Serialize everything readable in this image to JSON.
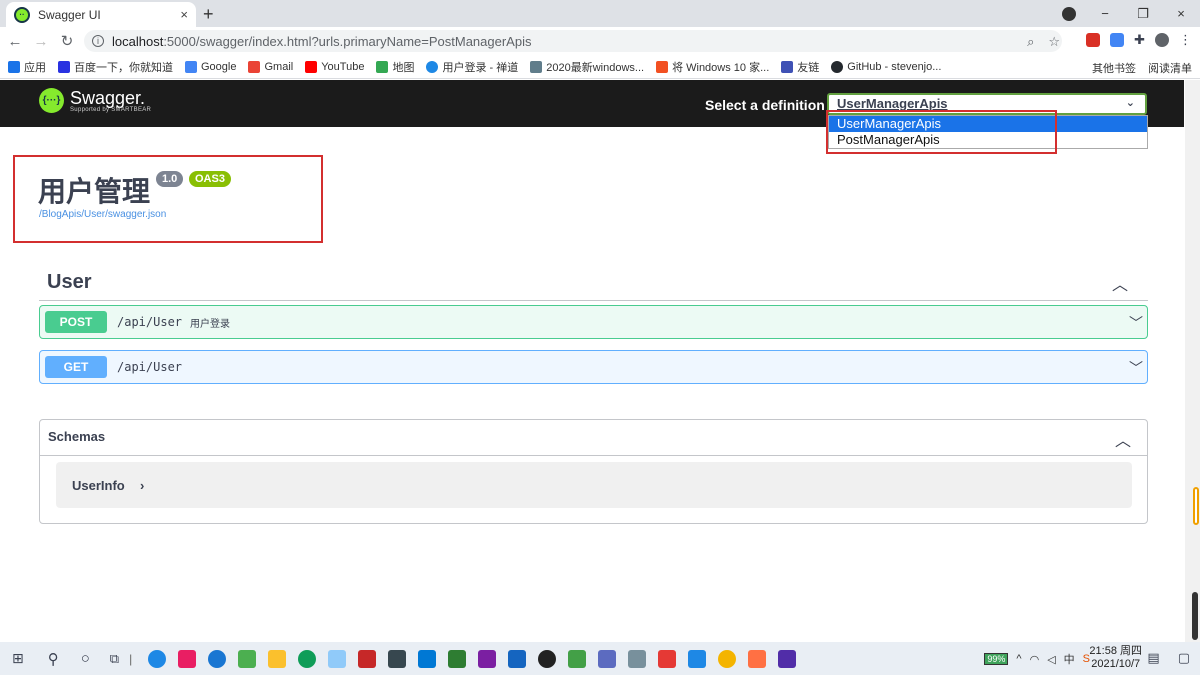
{
  "browser": {
    "tab_title": "Swagger UI",
    "tab_close": "×",
    "new_tab": "+",
    "url_host": "localhost",
    "url_rest": ":5000/swagger/index.html?urls.primaryName=PostManagerApis",
    "window_controls": [
      "−",
      "❐",
      "×"
    ],
    "bookmarks": [
      {
        "label": "应用",
        "color": "#1a73e8"
      },
      {
        "label": "百度一下，你就知道",
        "color": "#2932e1"
      },
      {
        "label": "Google",
        "color": "#4285f4"
      },
      {
        "label": "Gmail",
        "color": "#ea4335"
      },
      {
        "label": "YouTube",
        "color": "#ff0000"
      },
      {
        "label": "地图",
        "color": "#34a853"
      },
      {
        "label": "用户登录 - 禅道",
        "color": "#1e88e5"
      },
      {
        "label": "2020最新windows...",
        "color": "#607d8b"
      },
      {
        "label": "将 Windows 10 家...",
        "color": "#f25022"
      },
      {
        "label": "友链",
        "color": "#3f51b5"
      },
      {
        "label": "GitHub - stevenjo...",
        "color": "#24292e"
      }
    ],
    "bookmarks_right": [
      "其他书签",
      "阅读清单"
    ]
  },
  "swagger": {
    "logo_icon": "{···}",
    "logo_text": "Swagger.",
    "logo_sub": "Supported by SMARTBEAR",
    "definition_label": "Select a definition",
    "definition_selected": "UserManagerApis",
    "definition_options": [
      "UserManagerApis",
      "PostManagerApis"
    ],
    "title": "用户管理",
    "version": "1.0",
    "oas": "OAS3",
    "spec_url": "/BlogApis/User/swagger.json",
    "tag_name": "User",
    "operations": [
      {
        "method": "POST",
        "path": "/api/User",
        "summary": "用户登录"
      },
      {
        "method": "GET",
        "path": "/api/User",
        "summary": ""
      }
    ],
    "schemas_title": "Schemas",
    "schemas": [
      {
        "name": "UserInfo"
      }
    ]
  },
  "taskbar": {
    "battery": "99%",
    "ime": "中",
    "time": "21:58 周四",
    "date": "2021/10/7"
  }
}
